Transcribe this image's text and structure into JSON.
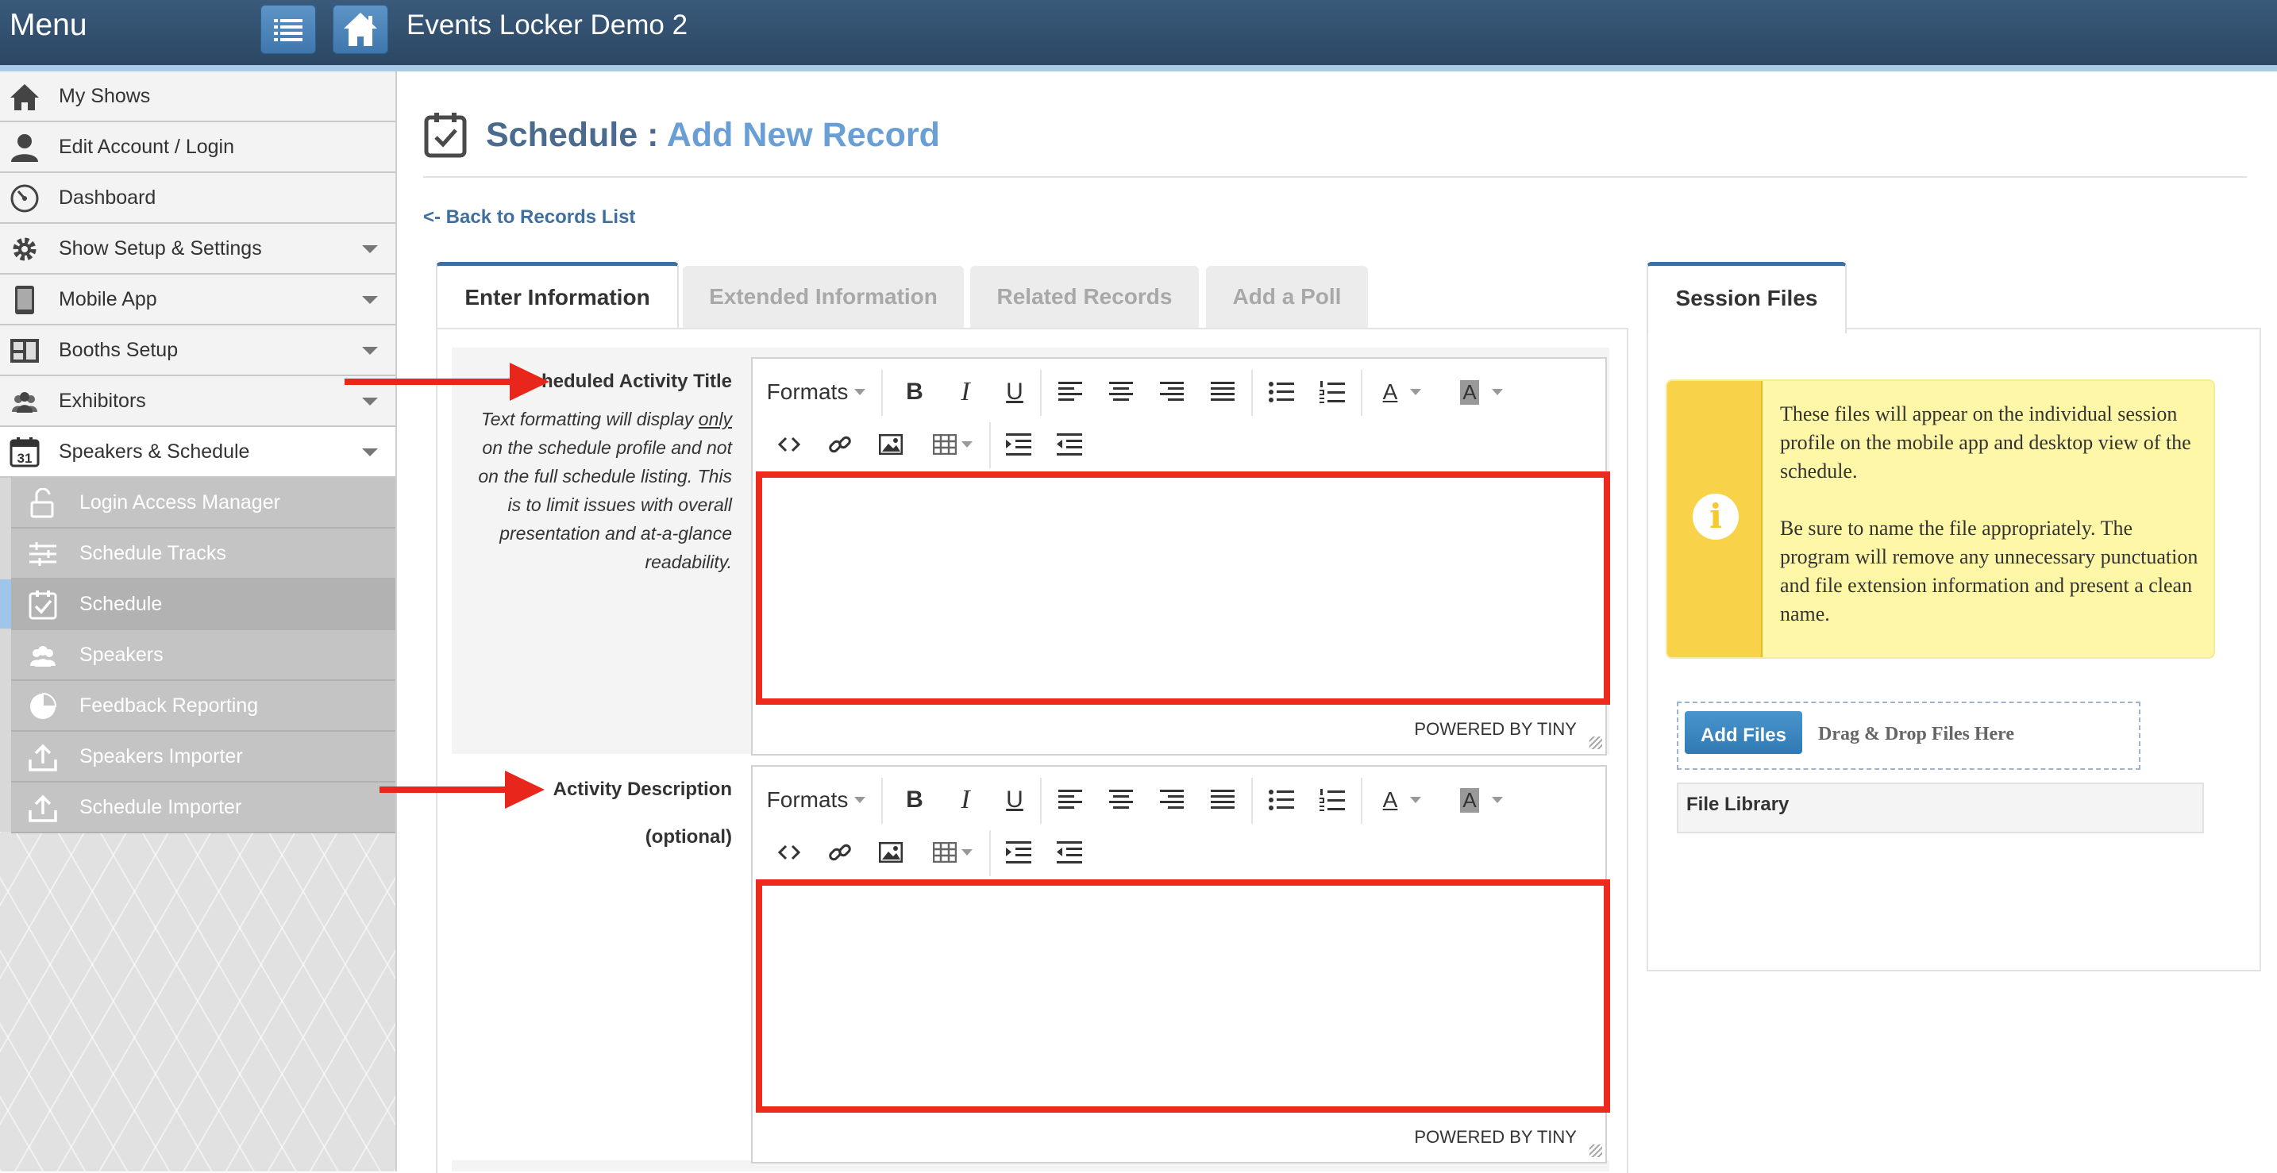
{
  "app": {
    "menu_title": "Menu",
    "title": "Events Locker Demo 2"
  },
  "topbar": {
    "list_icon": "list-icon",
    "home_icon": "home-icon"
  },
  "sidebar": {
    "items": [
      {
        "label": "My Shows",
        "icon": "home-icon",
        "has_caret": false
      },
      {
        "label": "Edit Account / Login",
        "icon": "user-icon",
        "has_caret": false
      },
      {
        "label": "Dashboard",
        "icon": "dashboard-gauge-icon",
        "has_caret": false
      },
      {
        "label": "Show Setup & Settings",
        "icon": "gear-icon",
        "has_caret": true
      },
      {
        "label": "Mobile App",
        "icon": "tablet-icon",
        "has_caret": true
      },
      {
        "label": "Booths Setup",
        "icon": "booth-layout-icon",
        "has_caret": true
      },
      {
        "label": "Exhibitors",
        "icon": "people-group-icon",
        "has_caret": true
      },
      {
        "label": "Speakers & Schedule",
        "icon": "calendar-icon",
        "calendar_day": "31",
        "has_caret": true,
        "active": true
      }
    ],
    "sub_items": [
      {
        "label": "Login Access Manager",
        "icon": "unlock-icon"
      },
      {
        "label": "Schedule Tracks",
        "icon": "sliders-icon"
      },
      {
        "label": "Schedule",
        "icon": "calendar-check-icon",
        "current": true
      },
      {
        "label": "Speakers",
        "icon": "people-group-icon"
      },
      {
        "label": "Feedback Reporting",
        "icon": "pie-chart-icon"
      },
      {
        "label": "Speakers Importer",
        "icon": "upload-icon"
      },
      {
        "label": "Schedule Importer",
        "icon": "upload-icon"
      }
    ]
  },
  "header": {
    "title_prefix": "Schedule : ",
    "title_accent": "Add New Record",
    "back_link": "<- Back to Records List"
  },
  "tabs": [
    {
      "label": "Enter Information",
      "active": true
    },
    {
      "label": "Extended Information"
    },
    {
      "label": "Related Records"
    },
    {
      "label": "Add a Poll"
    }
  ],
  "form": {
    "title_field": {
      "label": "Scheduled Activity Title",
      "help_before": "Text formatting will display ",
      "help_underlined": "only",
      "help_after": " on the schedule profile and not on the full schedule listing. This is to limit issues with overall presentation and at-a-glance readability.",
      "value": ""
    },
    "description_field": {
      "label": "Activity Description",
      "label_sub": "(optional)",
      "value": ""
    }
  },
  "editor": {
    "formats_label": "Formats",
    "powered_by": "POWERED BY TINY",
    "bold_glyph": "B",
    "italic_glyph": "I",
    "underline_glyph": "U",
    "text_color_glyph": "A",
    "bg_color_glyph": "A",
    "highlight_color": "#ee2a1c"
  },
  "session_files": {
    "tab_label": "Session Files",
    "info_paragraph_1": "These files will appear on the individual session profile on the mobile app and desktop view of the schedule.",
    "info_paragraph_2": "Be sure to name the file appropriately. The program will remove any unnecessary punctuation and file extension information and present a clean name.",
    "info_icon_glyph": "i",
    "add_files_label": "Add Files",
    "drop_label": "Drag & Drop Files Here",
    "file_library_label": "File Library"
  },
  "colors": {
    "topbar": "#2f4d6c",
    "accent_blue": "#3e6f9e",
    "title_accent": "#6a9fd6",
    "annotation_red": "#e8261b",
    "info_yellow": "#fff7a8"
  }
}
